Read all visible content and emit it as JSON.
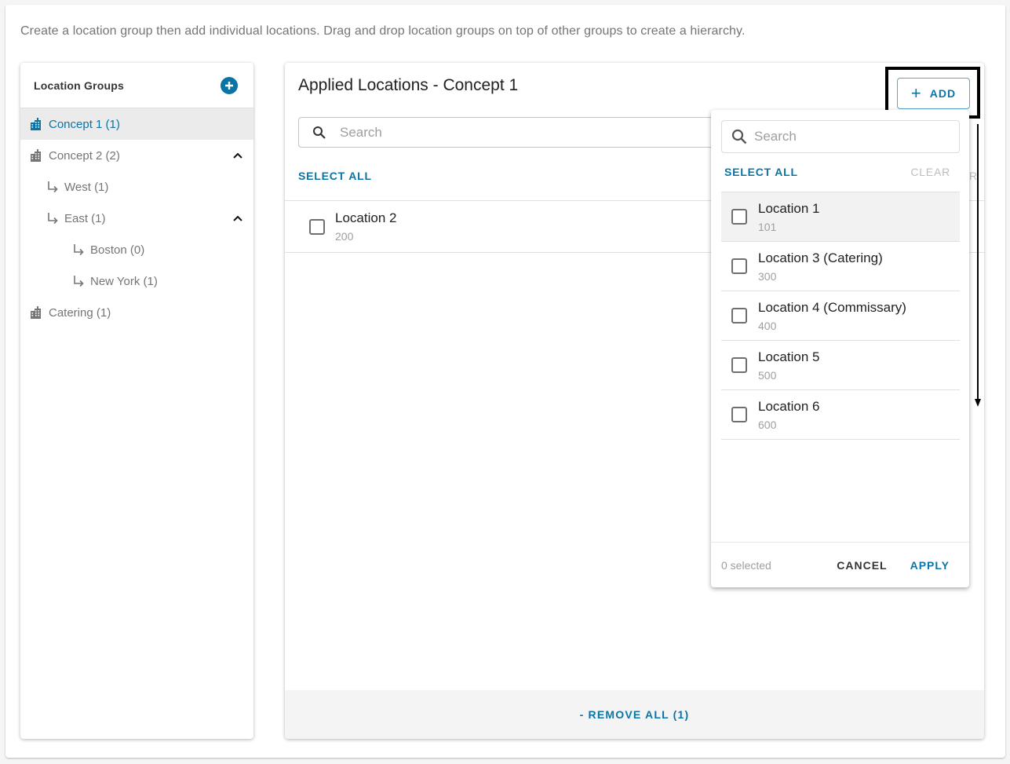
{
  "intro_text": "Create a location group then add individual locations. Drag and drop location groups on top of other groups to create a hierarchy.",
  "sidebar": {
    "title": "Location Groups",
    "add_icon": "plus-circle-icon",
    "items": [
      {
        "label": "Concept 1 (1)",
        "level": 0,
        "icon": "building-icon",
        "selected": true,
        "expanded": null
      },
      {
        "label": "Concept 2 (2)",
        "level": 0,
        "icon": "building-icon",
        "selected": false,
        "expanded": true
      },
      {
        "label": "West (1)",
        "level": 1,
        "icon": "subdirectory-arrow-icon",
        "selected": false,
        "expanded": null
      },
      {
        "label": "East (1)",
        "level": 1,
        "icon": "subdirectory-arrow-icon",
        "selected": false,
        "expanded": true
      },
      {
        "label": "Boston (0)",
        "level": 2,
        "icon": "subdirectory-arrow-icon",
        "selected": false,
        "expanded": null
      },
      {
        "label": "New York (1)",
        "level": 2,
        "icon": "subdirectory-arrow-icon",
        "selected": false,
        "expanded": null
      },
      {
        "label": "Catering (1)",
        "level": 0,
        "icon": "building-icon",
        "selected": false,
        "expanded": null
      }
    ]
  },
  "main": {
    "title": "Applied Locations - Concept 1",
    "add_button": {
      "label": "ADD",
      "icon": "plus-icon"
    },
    "search": {
      "placeholder": "Search",
      "value": ""
    },
    "select_all_label": "SELECT ALL",
    "clear_partial": "R",
    "locations": [
      {
        "name": "Location 2",
        "number": "200",
        "checked": false
      }
    ],
    "remove_all_label": "- REMOVE ALL (1)"
  },
  "dropdown": {
    "search": {
      "placeholder": "Search",
      "value": ""
    },
    "select_all_label": "SELECT ALL",
    "clear_label": "CLEAR",
    "locations": [
      {
        "name": "Location 1",
        "number": "101",
        "checked": false
      },
      {
        "name": "Location 3 (Catering)",
        "number": "300",
        "checked": false
      },
      {
        "name": "Location 4 (Commissary)",
        "number": "400",
        "checked": false
      },
      {
        "name": "Location 5",
        "number": "500",
        "checked": false
      },
      {
        "name": "Location 6",
        "number": "600",
        "checked": false
      }
    ],
    "selected_count": "0 selected",
    "cancel_label": "CANCEL",
    "apply_label": "APPLY"
  },
  "colors": {
    "accent": "#0a74a6",
    "selected_bg": "#ebebeb",
    "muted_text": "#757575"
  }
}
